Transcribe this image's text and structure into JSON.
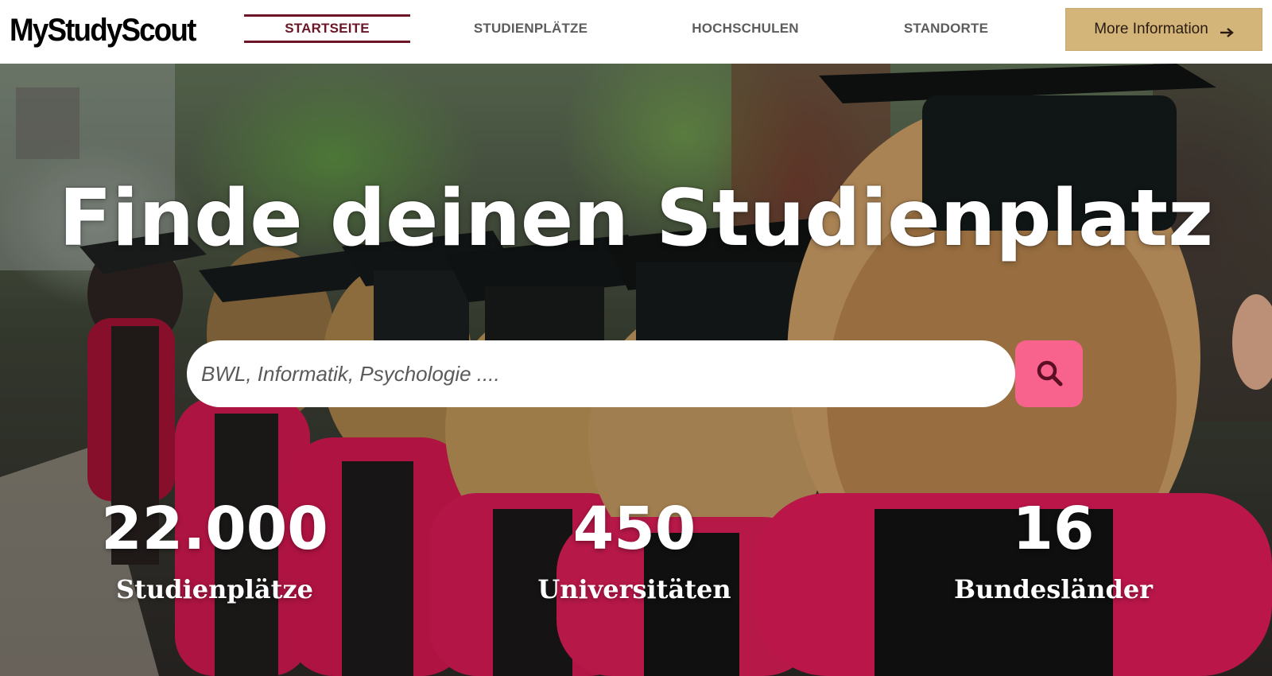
{
  "header": {
    "logo": "MyStudyScout",
    "nav": [
      {
        "label": "STARTSEITE",
        "active": true
      },
      {
        "label": "STUDIENPLÄTZE",
        "active": false
      },
      {
        "label": "HOCHSCHULEN",
        "active": false
      },
      {
        "label": "STANDORTE",
        "active": false
      }
    ],
    "more_button": {
      "label": "More Information",
      "icon": "arrow-right-icon"
    }
  },
  "hero": {
    "title": "Finde deinen Studienplatz",
    "search": {
      "placeholder": "BWL, Informatik, Psychologie ....",
      "value": "",
      "button_icon": "search-icon"
    },
    "stats": [
      {
        "value": "22.000",
        "label": "Studienplätze"
      },
      {
        "value": "450",
        "label": "Universitäten"
      },
      {
        "value": "16",
        "label": "Bundesländer"
      }
    ]
  },
  "colors": {
    "nav_active": "#6b1527",
    "nav_inactive": "#5c5c5c",
    "more_button_bg": "#d3b57a",
    "search_button_bg": "#f7638c",
    "gown_red": "#b8123f",
    "hero_text": "#ffffff"
  }
}
